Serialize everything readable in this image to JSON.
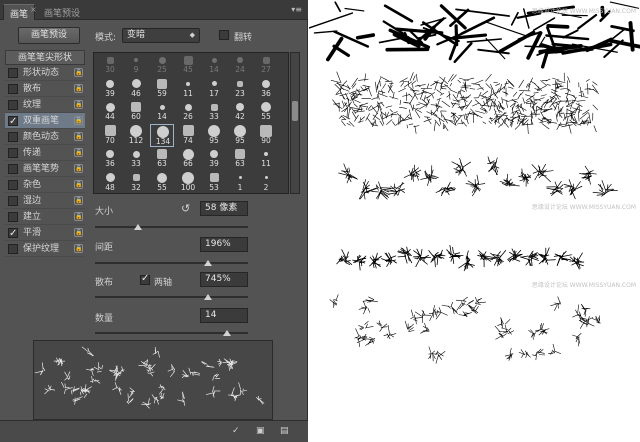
{
  "tabs": [
    {
      "label": "画笔",
      "active": true
    },
    {
      "label": "画笔预设",
      "active": false
    }
  ],
  "presets_button": "画笔预设",
  "mode_label": "模式:",
  "mode_value": "变暗",
  "flip_label": "翻转",
  "options_header": "画笔笔尖形状",
  "options": [
    {
      "label": "形状动态",
      "checked": false,
      "selected": false
    },
    {
      "label": "散布",
      "checked": false,
      "selected": false
    },
    {
      "label": "纹理",
      "checked": false,
      "selected": false
    },
    {
      "label": "双重画笔",
      "checked": true,
      "selected": true
    },
    {
      "label": "颜色动态",
      "checked": false,
      "selected": false
    },
    {
      "label": "传递",
      "checked": false,
      "selected": false
    },
    {
      "label": "画笔笔势",
      "checked": false,
      "selected": false
    },
    {
      "label": "杂色",
      "checked": false,
      "selected": false
    },
    {
      "label": "湿边",
      "checked": false,
      "selected": false
    },
    {
      "label": "建立",
      "checked": false,
      "selected": false
    },
    {
      "label": "平滑",
      "checked": true,
      "selected": false
    },
    {
      "label": "保护纹理",
      "checked": false,
      "selected": false
    }
  ],
  "brushes": [
    [
      "30",
      "9",
      "25",
      "45",
      "14",
      "24",
      "27"
    ],
    [
      "39",
      "46",
      "59",
      "11",
      "17",
      "23",
      "36"
    ],
    [
      "44",
      "60",
      "14",
      "26",
      "33",
      "42",
      "55"
    ],
    [
      "70",
      "112",
      "134",
      "74",
      "95",
      "95",
      "90"
    ],
    [
      "36",
      "33",
      "63",
      "66",
      "39",
      "63",
      "11"
    ],
    [
      "48",
      "32",
      "55",
      "100",
      "53",
      "1",
      "2"
    ]
  ],
  "faded_row": 0,
  "selected_brush": {
    "row": 3,
    "col": 2
  },
  "size_label": "大小",
  "size_value": "58 像素",
  "spacing_label": "间距",
  "spacing_value": "196%",
  "scatter_label": "散布",
  "both_axes_label": "两轴",
  "both_axes_checked": true,
  "scatter_value": "745%",
  "count_label": "数量",
  "count_value": "14",
  "sliders": {
    "size": 0.28,
    "spacing": 0.74,
    "scatter": 0.74,
    "count": 0.86
  },
  "watermarks": [
    "思缘设计论坛 WWW.MISSYUAN.COM",
    "思缘设计论坛 WWW.MISSYUAN.COM",
    "思缘设计论坛 WWW.MISSYUAN.COM"
  ],
  "icons": {
    "tab_close": "×",
    "menu": "▾≡",
    "reset": "↺",
    "bottom": [
      "✓",
      "▣",
      "▤"
    ]
  }
}
